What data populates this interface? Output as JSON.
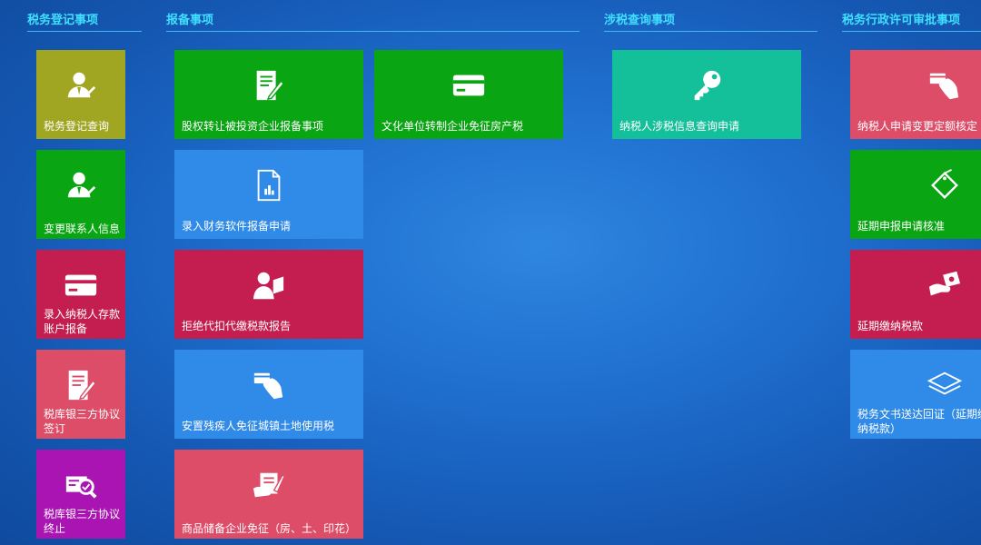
{
  "headers": {
    "registration": "税务登记事项",
    "filing": "报备事项",
    "inquiry": "涉税查询事项",
    "permit": "税务行政许可审批事项"
  },
  "colors": {
    "olive": "#a0a622",
    "green": "#0aa512",
    "crimson": "#c41d4f",
    "pink": "#dd4d68",
    "purple": "#aa14b3",
    "blue": "#2f8ae8",
    "teal": "#14c09a",
    "header": "#3fe0ff"
  },
  "registration": {
    "query": {
      "label": "税务登记查询",
      "icon": "user-pen-icon"
    },
    "change_contact": {
      "label": "变更联系人信息",
      "icon": "user-pen-icon"
    },
    "deposit_account": {
      "label": "录入纳税人存款账户报备",
      "icon": "card-icon"
    },
    "tripartite_sign": {
      "label": "税库银三方协议签订",
      "icon": "document-pen-icon"
    },
    "tripartite_end": {
      "label": "税库银三方协议终止",
      "icon": "search-check-icon"
    }
  },
  "filing": {
    "equity_transfer": {
      "label": "股权转让被投资企业报备事项",
      "icon": "document-pen-icon"
    },
    "cultural_unit": {
      "label": "文化单位转制企业免征房产税",
      "icon": "card-icon"
    },
    "finance_software": {
      "label": "录入财务软件报备申请",
      "icon": "file-chart-icon"
    },
    "refuse_withhold": {
      "label": "拒绝代扣代缴税款报告",
      "icon": "person-board-icon"
    },
    "disabled_land": {
      "label": "安置残疾人免征城镇土地使用税",
      "icon": "hand-card-icon"
    },
    "commodity_reserve": {
      "label": "商品储备企业免征（房、土、印花）",
      "icon": "hand-document-icon"
    }
  },
  "inquiry": {
    "taxpayer_info": {
      "label": "纳税人涉税信息查询申请",
      "icon": "key-icon"
    }
  },
  "permit": {
    "change_quota": {
      "label": "纳税人申请变更定额核定",
      "icon": "hand-card-icon"
    },
    "extend_filing": {
      "label": "延期申报申请核准",
      "icon": "tag-icon"
    },
    "extend_payment": {
      "label": "延期缴纳税款",
      "icon": "hand-money-icon"
    },
    "document_receipt": {
      "label": "税务文书送达回证（延期缴纳税款）",
      "icon": "layers-icon"
    }
  }
}
